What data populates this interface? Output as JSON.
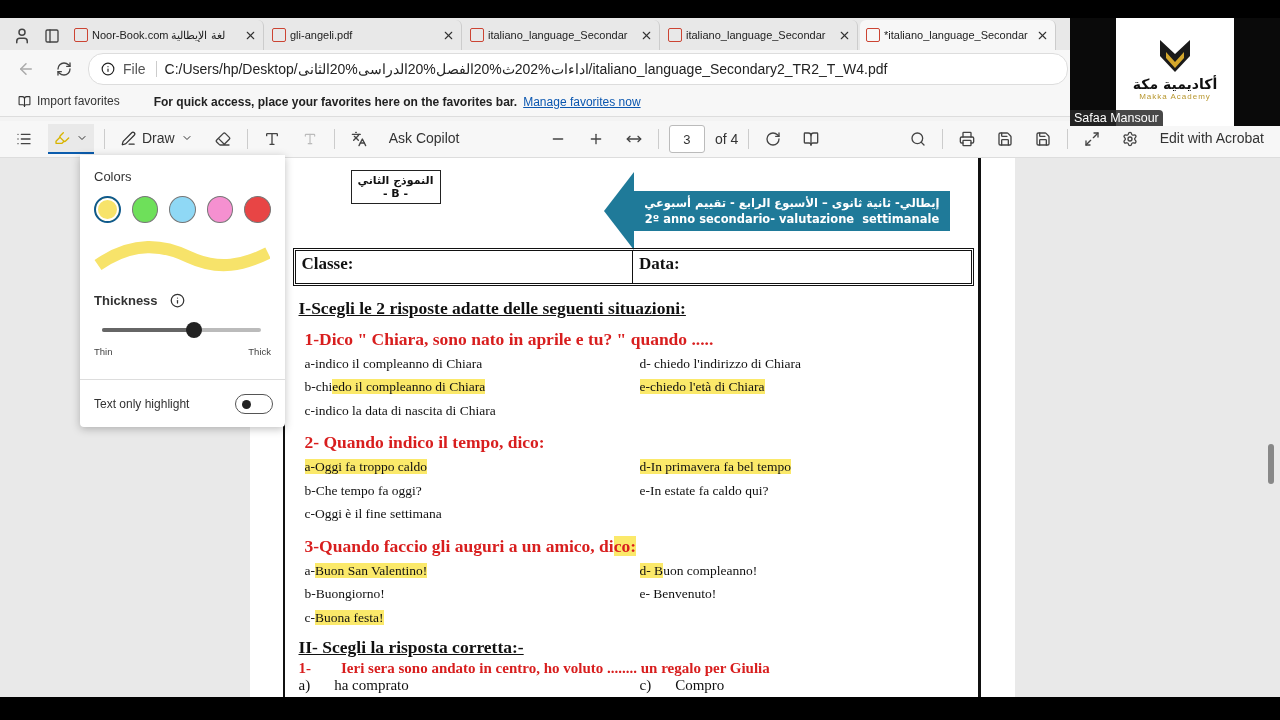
{
  "tabs": [
    {
      "title": "Noor-Book.com لغة الإيطالية",
      "selected": false
    },
    {
      "title": "gli-angeli.pdf",
      "selected": false
    },
    {
      "title": "italiano_language_Secondar",
      "selected": false
    },
    {
      "title": "italiano_language_Secondar",
      "selected": false
    },
    {
      "title": "*italiano_language_Secondar",
      "selected": true
    }
  ],
  "address": {
    "scheme": "File",
    "url": "C:/Users/hp/Desktop/اداءات%202ث%20الفصل%20الدراسى%20الثانى/italiano_language_Secondary2_TR2_T_W4.pdf"
  },
  "favorites_bar": {
    "import": "Import favorites",
    "message": "For quick access, place your favorites here on the favorites bar.",
    "link": "Manage favorites now"
  },
  "toolbar": {
    "draw": "Draw",
    "ask": "Ask Copilot",
    "page": "3",
    "page_count": "of 4",
    "edit": "Edit with Acrobat"
  },
  "highlight_panel": {
    "colors_label": "Colors",
    "colors": [
      {
        "color": "#f7e36a",
        "selected": true
      },
      {
        "color": "#6ee05a",
        "selected": false
      },
      {
        "color": "#8fd8f5",
        "selected": false
      },
      {
        "color": "#f590d0",
        "selected": false
      },
      {
        "color": "#e84545",
        "selected": false
      }
    ],
    "thickness_label": "Thickness",
    "level": 0.58,
    "min_label": "Thin",
    "max_label": "Thick",
    "text_only": {
      "label": "Text only highlight",
      "on": false
    }
  },
  "document": {
    "model_box": {
      "title": "النموذج الثاني",
      "code": "- B -"
    },
    "banner": {
      "arabic": "إيطالي- ثانية ثانوى – الأسبوع الرابع - تقييم أسبوعي",
      "italian": "2º anno secondario- valutazione  settimanale"
    },
    "fields": [
      "Classe:",
      "Data:"
    ],
    "section_1": {
      "title": "I-Scegli le 2 risposte adatte delle seguenti situazioni:",
      "questions": [
        {
          "title": [
            {
              "text": "1-Dico \" Chiara, sono nato in aprile e tu? \" quando .....",
              "highlighted": false
            }
          ],
          "left": [
            [
              {
                "text": "a-indico il compleanno di Chiara",
                "highlighted": false
              }
            ],
            [
              {
                "text": "b-chi",
                "highlighted": false
              },
              {
                "text": "edo il compleanno di Chiara",
                "highlighted": true
              }
            ],
            [
              {
                "text": "c-indico la data di nascita di Chiara",
                "highlighted": false
              }
            ]
          ],
          "right": [
            [
              {
                "text": "d- chiedo l'indirizzo di Chiara",
                "highlighted": false
              }
            ],
            [
              {
                "text": "e-chiedo l'età di Chiara",
                "highlighted": true
              }
            ]
          ]
        },
        {
          "title": [
            {
              "text": "2- Quando indico il tempo, dico:",
              "highlighted": false
            }
          ],
          "left": [
            [
              {
                "text": "a-Oggi fa troppo caldo",
                "highlighted": true
              }
            ],
            [
              {
                "text": "b-Che tempo fa oggi?",
                "highlighted": false
              }
            ],
            [
              {
                "text": "c-Oggi è il fine settimana",
                "highlighted": false
              }
            ]
          ],
          "right": [
            [
              {
                "text": "d-In primavera fa bel tempo",
                "highlighted": true
              }
            ],
            [
              {
                "text": "e-In estate fa caldo qui?",
                "highlighted": false
              }
            ]
          ]
        },
        {
          "title": [
            {
              "text": "3-Quando faccio gli auguri a un amico, di",
              "highlighted": false
            },
            {
              "text": "co:",
              "highlighted": true
            }
          ],
          "left": [
            [
              {
                "text": "a-",
                "highlighted": false
              },
              {
                "text": "Buon San Valentino!",
                "highlighted": true
              }
            ],
            [
              {
                "text": "b-Buongiorno!",
                "highlighted": false
              }
            ],
            [
              {
                "text": "c-",
                "highlighted": false
              },
              {
                "text": "Buona festa!",
                "highlighted": true
              }
            ]
          ],
          "right": [
            [
              {
                "text": "d- B",
                "highlighted": true
              },
              {
                "text": "uon compleanno!",
                "highlighted": false
              }
            ],
            [
              {
                "text": "e- Benvenuto!",
                "highlighted": false
              }
            ]
          ]
        }
      ]
    },
    "section_2": {
      "title": "II- Scegli la risposta corretta:-",
      "question": {
        "number": "1-",
        "text": "Ieri sera sono andato in centro, ho voluto ........ un regalo per Giulia"
      },
      "options": [
        {
          "letter": "a)",
          "text": "ha comprato"
        },
        {
          "letter": "c)",
          "text": "Compro"
        }
      ]
    }
  },
  "webcam": {
    "logo_text": "أكاديمية مكة",
    "logo_subtitle": "Makka Academy",
    "name": "Safaa Mansour"
  }
}
